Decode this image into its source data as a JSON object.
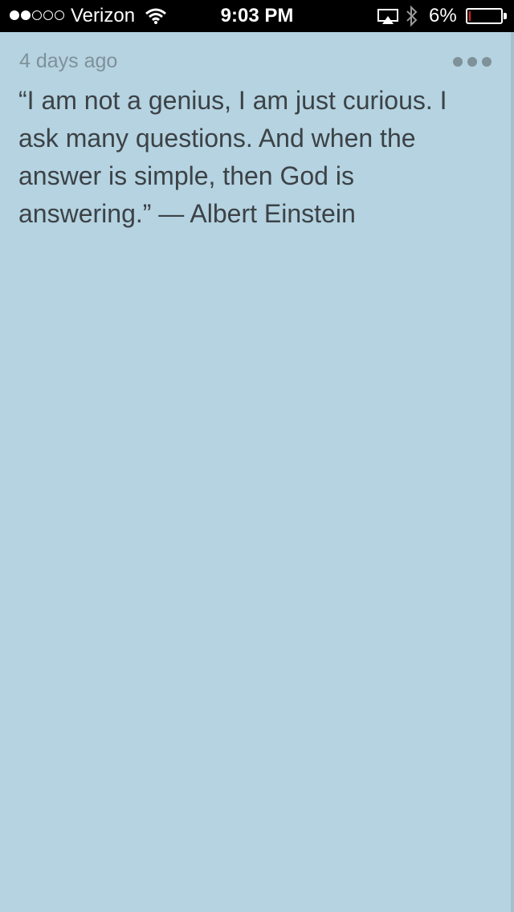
{
  "status_bar": {
    "signal_full": 2,
    "signal_total": 5,
    "carrier": "Verizon",
    "time": "9:03 PM",
    "battery_percent_label": "6%",
    "battery_level": 0.06,
    "battery_color": "#e02020",
    "icons": [
      "wifi-icon",
      "airplay-icon",
      "bluetooth-icon",
      "battery-icon"
    ]
  },
  "post": {
    "timestamp": "4 days ago",
    "text": "“I am not a genius, I am just curious. I ask many questions. And when the answer is simple, then God is answering.” — Albert Einstein",
    "more_icon": "more-options-icon"
  },
  "colors": {
    "background": "#b5d3e1",
    "text": "#3c4246",
    "muted": "#7f9199"
  }
}
